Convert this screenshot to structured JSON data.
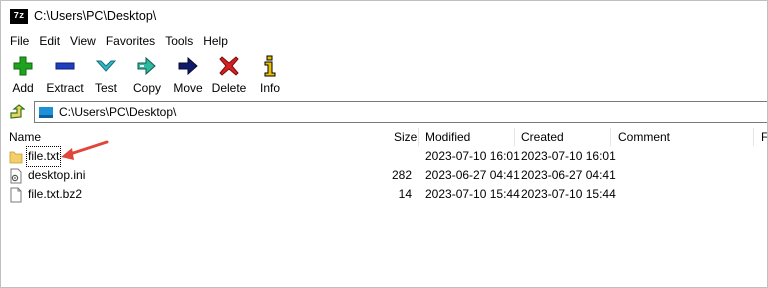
{
  "window": {
    "title": "C:\\Users\\PC\\Desktop\\",
    "app_icon_text": "7z"
  },
  "menu": [
    "File",
    "Edit",
    "View",
    "Favorites",
    "Tools",
    "Help"
  ],
  "toolbar": [
    {
      "label": "Add",
      "icon": "add-icon"
    },
    {
      "label": "Extract",
      "icon": "extract-icon"
    },
    {
      "label": "Test",
      "icon": "test-icon"
    },
    {
      "label": "Copy",
      "icon": "copy-icon"
    },
    {
      "label": "Move",
      "icon": "move-icon"
    },
    {
      "label": "Delete",
      "icon": "delete-icon"
    },
    {
      "label": "Info",
      "icon": "info-icon"
    }
  ],
  "address": {
    "path": "C:\\Users\\PC\\Desktop\\"
  },
  "columns": {
    "name": "Name",
    "size": "Size",
    "modified": "Modified",
    "created": "Created",
    "comment": "Comment",
    "folders": "F"
  },
  "files": [
    {
      "name": "file.txt",
      "size": "",
      "modified": "2023-07-10 16:01",
      "created": "2023-07-10 16:01",
      "icon": "folder-icon",
      "focused": true
    },
    {
      "name": "desktop.ini",
      "size": "282",
      "modified": "2023-06-27 04:41",
      "created": "2023-06-27 04:41",
      "icon": "settings-file-icon",
      "focused": false
    },
    {
      "name": "file.txt.bz2",
      "size": "14",
      "modified": "2023-07-10 15:44",
      "created": "2023-07-10 15:44",
      "icon": "file-icon",
      "focused": false
    }
  ],
  "colors": {
    "add": "#1fa31f",
    "extract": "#1f3fbf",
    "test": "#2fb8c8",
    "move": "#101a6a",
    "delete": "#d42020",
    "info": "#e8c000",
    "folder": "#f2cf6b",
    "arrow": "#e0473a"
  }
}
